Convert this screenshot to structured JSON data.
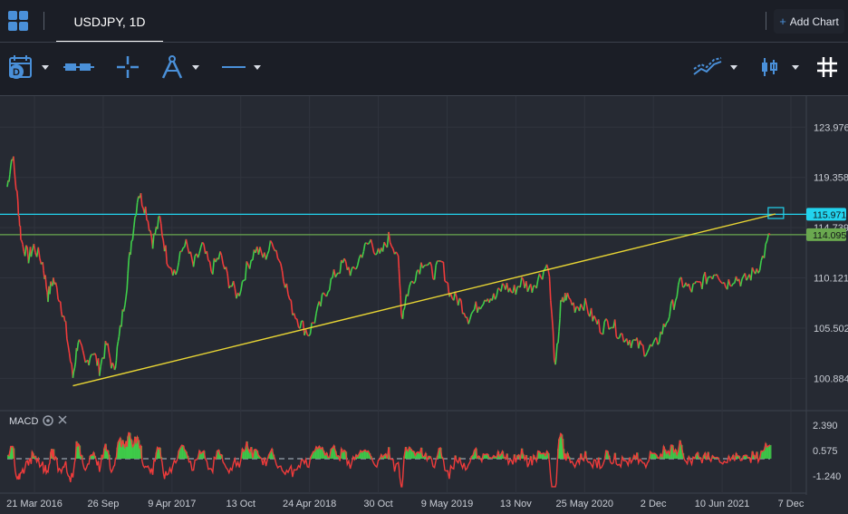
{
  "header": {
    "tab_label": "USDJPY, 1D",
    "add_chart_label": "Add Chart",
    "add_chart_plus": "+"
  },
  "toolbar": {
    "tools": [
      {
        "name": "date-range-tool",
        "icon": "calendar-d-icon"
      },
      {
        "name": "chart-type-tool",
        "icon": "bars-icon"
      },
      {
        "name": "crosshair-tool",
        "icon": "crosshair-icon"
      },
      {
        "name": "drawing-tool",
        "icon": "compass-icon"
      },
      {
        "name": "line-style-tool",
        "icon": "line-icon"
      },
      {
        "name": "indicators-tool",
        "icon": "trend-lines-icon"
      },
      {
        "name": "candle-style-tool",
        "icon": "candlestick-icon"
      },
      {
        "name": "grid-toggle-tool",
        "icon": "hash-icon"
      }
    ]
  },
  "chart_data": {
    "type": "line",
    "symbol": "USDJPY, 1D",
    "y_axis_ticks": [
      "123.976",
      "119.358",
      "114.739",
      "110.121",
      "105.502",
      "100.884"
    ],
    "y_range": [
      98.5,
      126.5
    ],
    "x_axis_ticks": [
      "21 Mar 2016",
      "26 Sep",
      "9 Apr 2017",
      "13 Oct",
      "24 Apr 2018",
      "30 Oct",
      "9 May 2019",
      "13 Nov",
      "25 May 2020",
      "2 Dec",
      "10 Jun 2021",
      "7 Dec"
    ],
    "price_series": {
      "up_color": "#3fcf4a",
      "down_color": "#ef3b3b",
      "points": [
        [
          0,
          118.5
        ],
        [
          0.6,
          121.5
        ],
        [
          1.2,
          117.0
        ],
        [
          1.6,
          113.5
        ],
        [
          2.4,
          112.0
        ],
        [
          3.0,
          113.0
        ],
        [
          4.0,
          111.5
        ],
        [
          4.6,
          108.5
        ],
        [
          5.2,
          110.0
        ],
        [
          6.0,
          108.0
        ],
        [
          6.6,
          105.5
        ],
        [
          7.4,
          101.0
        ],
        [
          8.0,
          104.5
        ],
        [
          8.8,
          102.0
        ],
        [
          9.6,
          103.5
        ],
        [
          10.4,
          101.8
        ],
        [
          11.2,
          104.0
        ],
        [
          12.0,
          101.5
        ],
        [
          12.6,
          104.5
        ],
        [
          13.4,
          109.0
        ],
        [
          14.0,
          113.5
        ],
        [
          14.8,
          118.0
        ],
        [
          15.6,
          116.5
        ],
        [
          16.4,
          113.5
        ],
        [
          17.2,
          115.5
        ],
        [
          18.0,
          112.0
        ],
        [
          19.0,
          110.5
        ],
        [
          20.0,
          113.5
        ],
        [
          21.0,
          111.2
        ],
        [
          22.0,
          113.0
        ],
        [
          23.0,
          110.8
        ],
        [
          24.0,
          112.2
        ],
        [
          25.0,
          109.8
        ],
        [
          26.0,
          108.5
        ],
        [
          27.0,
          111.0
        ],
        [
          28.0,
          112.8
        ],
        [
          29.0,
          112.0
        ],
        [
          30.0,
          113.5
        ],
        [
          31.0,
          111.0
        ],
        [
          32.0,
          107.5
        ],
        [
          33.0,
          106.0
        ],
        [
          34.0,
          105.0
        ],
        [
          35.0,
          107.0
        ],
        [
          36.0,
          109.0
        ],
        [
          37.0,
          110.5
        ],
        [
          38.0,
          111.5
        ],
        [
          39.0,
          110.5
        ],
        [
          40.0,
          112.5
        ],
        [
          41.0,
          113.5
        ],
        [
          42.0,
          112.0
        ],
        [
          43.0,
          113.8
        ],
        [
          44.0,
          112.5
        ],
        [
          44.5,
          106.5
        ],
        [
          45.0,
          108.5
        ],
        [
          46.0,
          110.5
        ],
        [
          47.0,
          111.8
        ],
        [
          48.0,
          110.5
        ],
        [
          49.0,
          111.5
        ],
        [
          50.0,
          108.5
        ],
        [
          51.0,
          108.0
        ],
        [
          52.0,
          106.5
        ],
        [
          53.0,
          107.5
        ],
        [
          54.0,
          108.5
        ],
        [
          55.0,
          108.2
        ],
        [
          56.0,
          109.5
        ],
        [
          57.0,
          108.8
        ],
        [
          58.0,
          109.8
        ],
        [
          59.0,
          109.2
        ],
        [
          60.0,
          110.2
        ],
        [
          61.0,
          111.5
        ],
        [
          61.8,
          101.5
        ],
        [
          62.4,
          107.5
        ],
        [
          63.0,
          108.5
        ],
        [
          64.0,
          107.5
        ],
        [
          65.0,
          107.8
        ],
        [
          66.0,
          106.5
        ],
        [
          67.0,
          105.5
        ],
        [
          68.0,
          106.2
        ],
        [
          69.0,
          105.0
        ],
        [
          70.0,
          104.5
        ],
        [
          71.0,
          104.0
        ],
        [
          72.0,
          103.5
        ],
        [
          73.0,
          103.8
        ],
        [
          74.0,
          105.5
        ],
        [
          75.0,
          107.5
        ],
        [
          76.0,
          109.8
        ],
        [
          77.0,
          109.0
        ],
        [
          78.0,
          109.5
        ],
        [
          79.0,
          110.2
        ],
        [
          80.0,
          110.8
        ],
        [
          81.0,
          109.5
        ],
        [
          82.0,
          110.2
        ],
        [
          83.0,
          109.8
        ],
        [
          84.0,
          110.5
        ],
        [
          85.0,
          111.5
        ],
        [
          86.0,
          114.1
        ]
      ],
      "x_domain": [
        0,
        86
      ]
    },
    "horizontal_lines": [
      {
        "value": 115.971,
        "label": "115.971",
        "color": "#22d3ee"
      },
      {
        "value": 114.095,
        "label": "114.095",
        "color": "#6aa84f"
      }
    ],
    "trend_line": {
      "color": "#e8d534",
      "from": [
        7.4,
        100.2
      ],
      "to": [
        86.6,
        116.0
      ]
    },
    "macd": {
      "label": "MACD",
      "y_axis_ticks": [
        "2.390",
        "0.575",
        "-1.240"
      ],
      "y_range": [
        -2.2,
        3.1
      ],
      "signal_color": "#ef3b3b",
      "hist_color": "#3fcf4a",
      "zero_line_color": "#b7c1cc"
    }
  }
}
